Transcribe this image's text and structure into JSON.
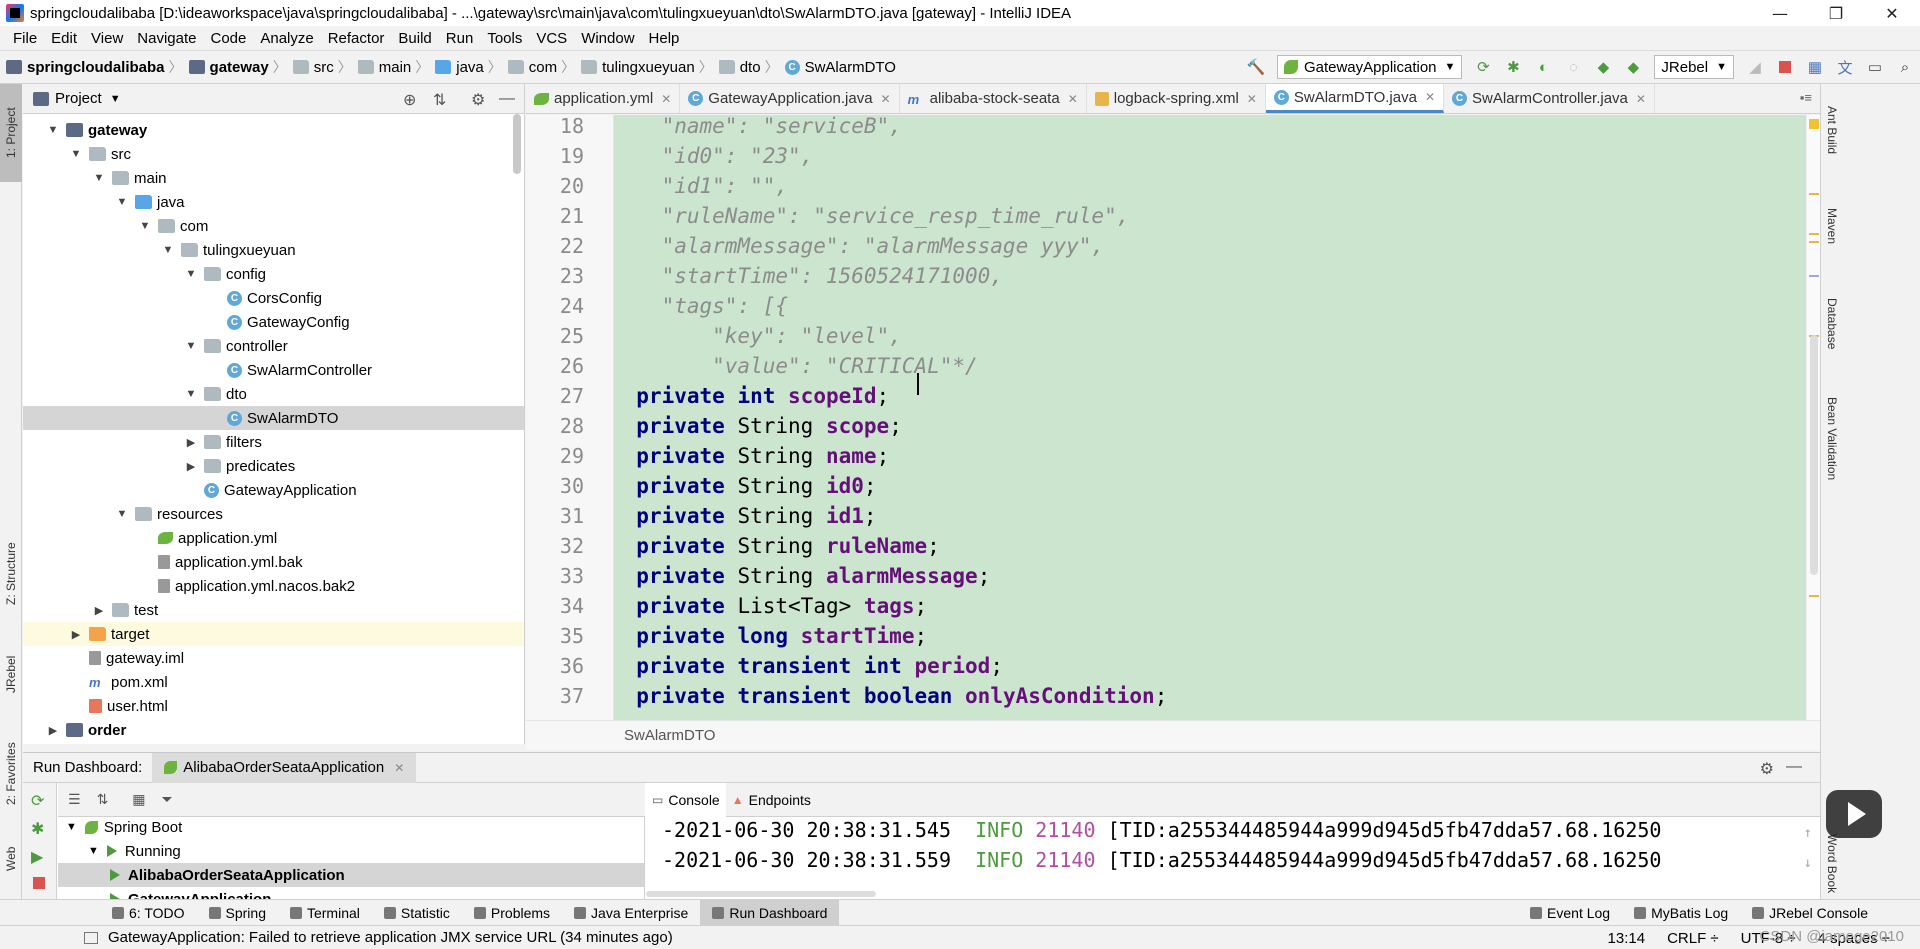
{
  "window": {
    "title": "springcloudalibaba [D:\\ideaworkspace\\java\\springcloudalibaba] - ...\\gateway\\src\\main\\java\\com\\tulingxueyuan\\dto\\SwAlarmDTO.java [gateway] - IntelliJ IDEA",
    "minimize": "—",
    "restore": "❐",
    "close": "✕"
  },
  "menu": [
    {
      "label": "File"
    },
    {
      "label": "Edit"
    },
    {
      "label": "View"
    },
    {
      "label": "Navigate"
    },
    {
      "label": "Code"
    },
    {
      "label": "Analyze"
    },
    {
      "label": "Refactor"
    },
    {
      "label": "Build"
    },
    {
      "label": "Run"
    },
    {
      "label": "Tools"
    },
    {
      "label": "VCS"
    },
    {
      "label": "Window"
    },
    {
      "label": "Help"
    }
  ],
  "navbar": {
    "crumbs": [
      "springcloudalibaba",
      "gateway",
      "src",
      "main",
      "java",
      "com",
      "tulingxueyuan",
      "dto",
      "SwAlarmDTO"
    ],
    "run_config": "GatewayApplication",
    "jrebel": "JRebel"
  },
  "left_stripe": {
    "project": "1: Project",
    "structure": "Z: Structure",
    "jrebel": "JRebel",
    "favorites": "2: Favorites",
    "web": "Web"
  },
  "right_stripe": {
    "ant": "Ant Build",
    "maven": "Maven",
    "database": "Database",
    "bean": "Bean Validation",
    "word": "Word Book"
  },
  "project_panel": {
    "title": "Project",
    "tree": [
      {
        "label": "gateway",
        "depth": 1,
        "arrow": "open",
        "icon": "module",
        "bold": true
      },
      {
        "label": "src",
        "depth": 2,
        "arrow": "open",
        "icon": "folder"
      },
      {
        "label": "main",
        "depth": 3,
        "arrow": "open",
        "icon": "folder"
      },
      {
        "label": "java",
        "depth": 4,
        "arrow": "open",
        "icon": "folder-blue"
      },
      {
        "label": "com",
        "depth": 5,
        "arrow": "open",
        "icon": "folder"
      },
      {
        "label": "tulingxueyuan",
        "depth": 6,
        "arrow": "open",
        "icon": "folder"
      },
      {
        "label": "config",
        "depth": 7,
        "arrow": "open",
        "icon": "folder"
      },
      {
        "label": "CorsConfig",
        "depth": 8,
        "arrow": "none",
        "icon": "class"
      },
      {
        "label": "GatewayConfig",
        "depth": 8,
        "arrow": "none",
        "icon": "class"
      },
      {
        "label": "controller",
        "depth": 7,
        "arrow": "open",
        "icon": "folder"
      },
      {
        "label": "SwAlarmController",
        "depth": 8,
        "arrow": "none",
        "icon": "class"
      },
      {
        "label": "dto",
        "depth": 7,
        "arrow": "open",
        "icon": "folder"
      },
      {
        "label": "SwAlarmDTO",
        "depth": 8,
        "arrow": "none",
        "icon": "class",
        "selected": true
      },
      {
        "label": "filters",
        "depth": 7,
        "arrow": "closed",
        "icon": "folder"
      },
      {
        "label": "predicates",
        "depth": 7,
        "arrow": "closed",
        "icon": "folder"
      },
      {
        "label": "GatewayApplication",
        "depth": 7,
        "arrow": "none",
        "icon": "class"
      },
      {
        "label": "resources",
        "depth": 4,
        "arrow": "open",
        "icon": "folder"
      },
      {
        "label": "application.yml",
        "depth": 5,
        "arrow": "none",
        "icon": "yml"
      },
      {
        "label": "application.yml.bak",
        "depth": 5,
        "arrow": "none",
        "icon": "file"
      },
      {
        "label": "application.yml.nacos.bak2",
        "depth": 5,
        "arrow": "none",
        "icon": "file"
      },
      {
        "label": "test",
        "depth": 3,
        "arrow": "closed",
        "icon": "folder"
      },
      {
        "label": "target",
        "depth": 2,
        "arrow": "closed",
        "icon": "folder-orange",
        "highlight": true
      },
      {
        "label": "gateway.iml",
        "depth": 2,
        "arrow": "none",
        "icon": "file"
      },
      {
        "label": "pom.xml",
        "depth": 2,
        "arrow": "none",
        "icon": "m"
      },
      {
        "label": "user.html",
        "depth": 2,
        "arrow": "none",
        "icon": "html"
      },
      {
        "label": "order",
        "depth": 1,
        "arrow": "closed",
        "icon": "module",
        "bold": true
      }
    ]
  },
  "editor_tabs": [
    {
      "label": "application.yml",
      "icon": "yml"
    },
    {
      "label": "GatewayApplication.java",
      "icon": "class"
    },
    {
      "label": "alibaba-stock-seata",
      "icon": "m"
    },
    {
      "label": "logback-spring.xml",
      "icon": "xml"
    },
    {
      "label": "SwAlarmDTO.java",
      "icon": "class",
      "active": true
    },
    {
      "label": "SwAlarmController.java",
      "icon": "class"
    }
  ],
  "editor": {
    "lines": [
      {
        "n": "18",
        "kind": "comment",
        "text": "    \"name\": \"serviceB\","
      },
      {
        "n": "19",
        "kind": "comment",
        "text": "    \"id0\": \"23\","
      },
      {
        "n": "20",
        "kind": "comment",
        "text": "    \"id1\": \"\","
      },
      {
        "n": "21",
        "kind": "comment",
        "text": "    \"ruleName\": \"service_resp_time_rule\","
      },
      {
        "n": "22",
        "kind": "comment",
        "text": "    \"alarmMessage\": \"alarmMessage yyy\","
      },
      {
        "n": "23",
        "kind": "comment",
        "text": "    \"startTime\": 1560524171000,"
      },
      {
        "n": "24",
        "kind": "comment",
        "text": "    \"tags\": [{"
      },
      {
        "n": "25",
        "kind": "comment",
        "text": "        \"key\": \"level\","
      },
      {
        "n": "26",
        "kind": "comment",
        "text": "        \"value\": \"CRITICAL\"*/"
      },
      {
        "n": "27",
        "kind": "field",
        "mods": "private int",
        "name": "scopeId"
      },
      {
        "n": "28",
        "kind": "field",
        "mods": "private",
        "type": "String",
        "name": "scope"
      },
      {
        "n": "29",
        "kind": "field",
        "mods": "private",
        "type": "String",
        "name": "name"
      },
      {
        "n": "30",
        "kind": "field",
        "mods": "private",
        "type": "String",
        "name": "id0"
      },
      {
        "n": "31",
        "kind": "field",
        "mods": "private",
        "type": "String",
        "name": "id1"
      },
      {
        "n": "32",
        "kind": "field",
        "mods": "private",
        "type": "String",
        "name": "ruleName"
      },
      {
        "n": "33",
        "kind": "field",
        "mods": "private",
        "type": "String",
        "name": "alarmMessage"
      },
      {
        "n": "34",
        "kind": "field",
        "mods": "private",
        "type": "List<Tag>",
        "name": "tags"
      },
      {
        "n": "35",
        "kind": "field",
        "mods": "private long",
        "name": "startTime"
      },
      {
        "n": "36",
        "kind": "field",
        "mods": "private transient int",
        "name": "period"
      },
      {
        "n": "37",
        "kind": "field",
        "mods": "private transient boolean",
        "name": "onlyAsCondition"
      }
    ],
    "breadcrumb": "SwAlarmDTO"
  },
  "run_dashboard": {
    "title": "Run Dashboard:",
    "tab": "AlibabaOrderSeataApplication",
    "tree": [
      {
        "label": "Spring Boot",
        "depth": 0
      },
      {
        "label": "Running",
        "depth": 1
      },
      {
        "label": "AlibabaOrderSeataApplication",
        "depth": 2,
        "selected": true
      },
      {
        "label": "GatewayApplication",
        "depth": 2
      }
    ],
    "console_tab": "Console",
    "endpoints_tab": "Endpoints",
    "logs": [
      {
        "time": "-2021-06-30 20:38:31.545",
        "level": "INFO",
        "pid": "21140",
        "rest": "[TID:a255344485944a999d945d5fb47dda57.68.16250"
      },
      {
        "time": "-2021-06-30 20:38:31.559",
        "level": "INFO",
        "pid": "21140",
        "rest": "[TID:a255344485944a999d945d5fb47dda57.68.16250"
      }
    ]
  },
  "tool_tabs": [
    {
      "label": "6: TODO"
    },
    {
      "label": "Spring"
    },
    {
      "label": "Terminal"
    },
    {
      "label": "Statistic"
    },
    {
      "label": "Problems"
    },
    {
      "label": "Java Enterprise"
    },
    {
      "label": "Run Dashboard",
      "active": true
    }
  ],
  "tool_tabs_right": [
    {
      "label": "Event Log"
    },
    {
      "label": "MyBatis Log"
    },
    {
      "label": "JRebel Console"
    }
  ],
  "status": {
    "message": "GatewayApplication: Failed to retrieve application JMX service URL (34 minutes ago)",
    "position": "13:14",
    "line_sep": "CRLF ÷",
    "encoding": "UTF-8 ÷",
    "indent": "4 spaces ÷",
    "watermark": "CSDN @iamege2010"
  }
}
